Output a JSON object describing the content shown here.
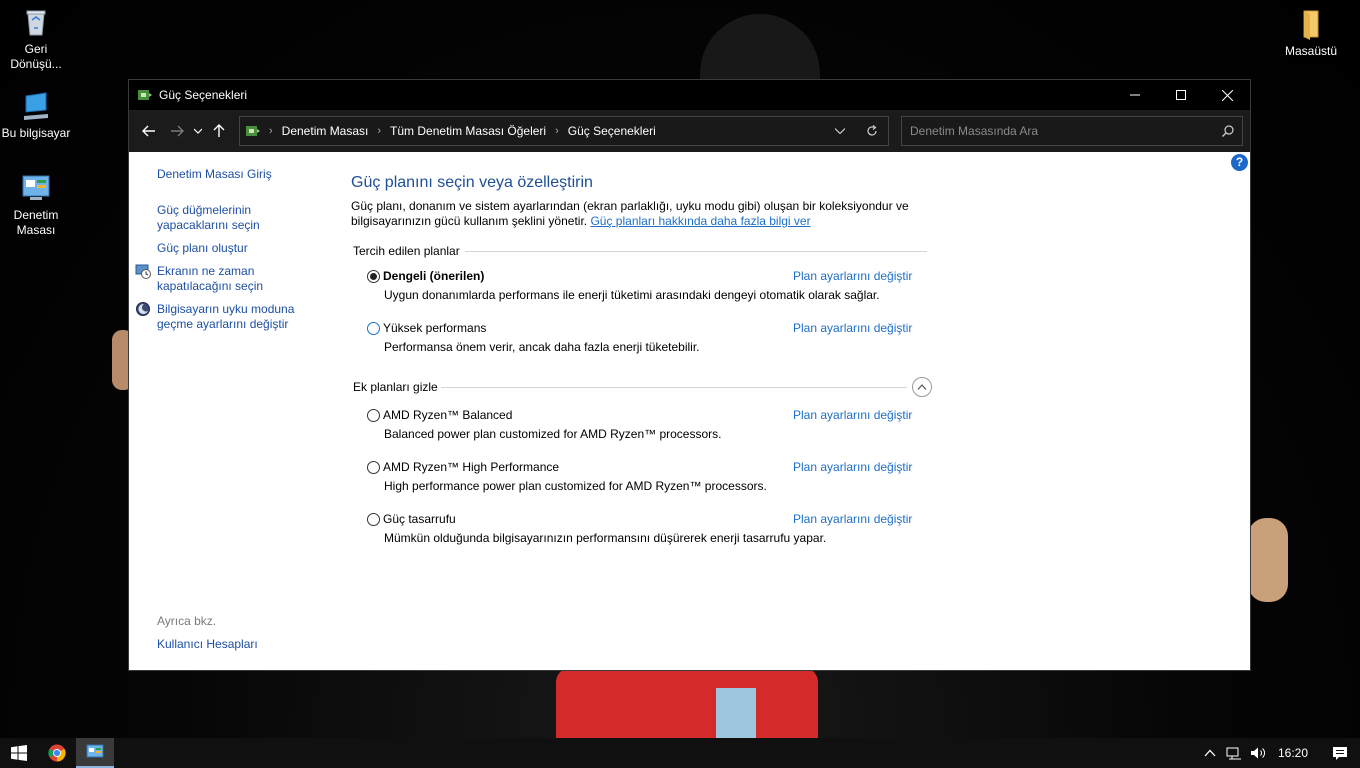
{
  "desktop": {
    "icons": [
      {
        "label": "Geri Dönüşü...",
        "icon": "recycle-bin-icon"
      },
      {
        "label": "Bu bilgisayar",
        "icon": "computer-icon"
      },
      {
        "label": "Denetim Masası",
        "icon": "control-panel-icon"
      },
      {
        "label": "Masaüstü",
        "icon": "folder-icon"
      }
    ]
  },
  "window": {
    "title": "Güç Seçenekleri",
    "breadcrumbs": [
      "Denetim Masası",
      "Tüm Denetim Masası Öğeleri",
      "Güç Seçenekleri"
    ],
    "search": {
      "placeholder": "Denetim Masasında Ara",
      "value": ""
    }
  },
  "sidebar": {
    "home": "Denetim Masası Giriş",
    "links": [
      "Güç düğmelerinin yapacaklarını seçin",
      "Güç planı oluştur",
      "Ekranın ne zaman kapatılacağını seçin",
      "Bilgisayarın uyku moduna geçme ayarlarını değiştir"
    ],
    "see_also_title": "Ayrıca bkz.",
    "see_also_links": [
      "Kullanıcı Hesapları"
    ]
  },
  "main": {
    "heading": "Güç planını seçin veya özelleştirin",
    "description": "Güç planı, donanım ve sistem ayarlarından (ekran parlaklığı, uyku modu gibi) oluşan bir koleksiyondur ve bilgisayarınızın gücü kullanım şeklini yönetir.",
    "learn_more": "Güç planları hakkında daha fazla bilgi ver",
    "preferred_title": "Tercih edilen planlar",
    "extra_title": "Ek planları gizle",
    "change_label": "Plan ayarlarını değiştir",
    "preferred_plans": [
      {
        "name": "Dengeli (önerilen)",
        "desc": "Uygun donanımlarda performans ile enerji tüketimi arasındaki dengeyi otomatik olarak sağlar.",
        "selected": true
      },
      {
        "name": "Yüksek performans",
        "desc": "Performansa önem verir, ancak daha fazla enerji tüketebilir.",
        "selected": false
      }
    ],
    "extra_plans": [
      {
        "name": "AMD Ryzen™ Balanced",
        "desc": "Balanced power plan customized for AMD Ryzen™ processors.",
        "selected": false
      },
      {
        "name": "AMD Ryzen™ High Performance",
        "desc": "High performance power plan customized for AMD Ryzen™ processors.",
        "selected": false
      },
      {
        "name": "Güç tasarrufu",
        "desc": "Mümkün olduğunda bilgisayarınızın performansını düşürerek enerji tasarrufu yapar.",
        "selected": false
      }
    ]
  },
  "taskbar": {
    "clock": "16:20"
  },
  "colors": {
    "link": "#1d6fc8",
    "heading": "#1e4f97",
    "titlebar": "#000000",
    "navbar": "#1b1b1b"
  }
}
